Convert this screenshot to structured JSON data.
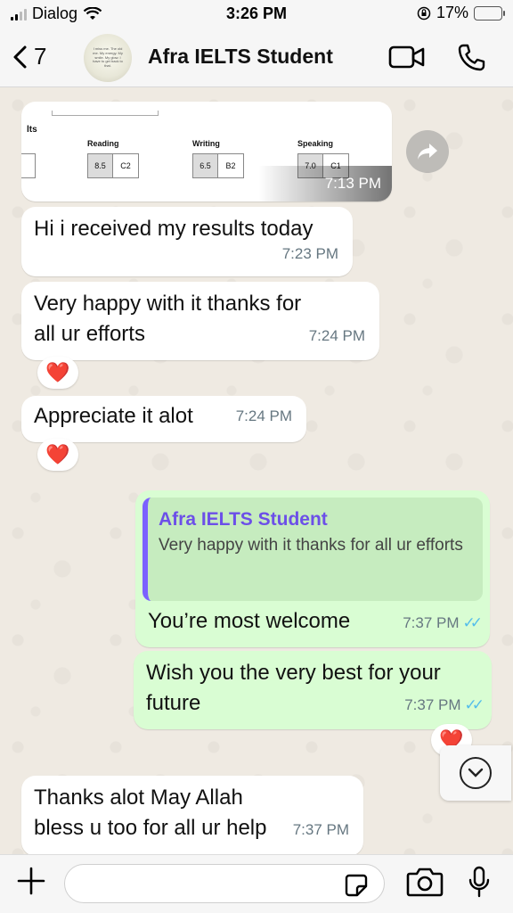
{
  "status": {
    "carrier": "Dialog",
    "time": "3:26 PM",
    "battery": "17%",
    "battery_level": 0.17
  },
  "header": {
    "back_count": "7",
    "title": "Afra IELTS Student",
    "avatar_text": "I miss me. The old me. My energy. My smile. My glow. I have to get back to that."
  },
  "image_message": {
    "partial_label": "lts",
    "columns": [
      {
        "label": "Reading",
        "score": "8.5",
        "level": "C2"
      },
      {
        "label": "Writing",
        "score": "6.5",
        "level": "B2"
      },
      {
        "label": "Speaking",
        "score": "7.0",
        "level": "C1"
      }
    ],
    "time": "7:13 PM"
  },
  "messages": [
    {
      "id": "m1",
      "dir": "in",
      "text": "Hi i received my results today",
      "time": "7:23 PM"
    },
    {
      "id": "m2",
      "dir": "in",
      "text": "Very happy with it thanks for all ur efforts",
      "time": "7:24 PM",
      "reaction": "❤️"
    },
    {
      "id": "m3",
      "dir": "in",
      "text": "Appreciate it alot",
      "time": "7:24 PM",
      "reaction": "❤️"
    },
    {
      "id": "m4",
      "dir": "out",
      "quote_name": "Afra IELTS Student",
      "quote_text": "Very happy with it thanks for all ur efforts",
      "text": "You’re most welcome",
      "time": "7:37 PM"
    },
    {
      "id": "m5",
      "dir": "out",
      "text": "Wish you the very best for your future",
      "time": "7:37 PM",
      "reaction": "❤️"
    },
    {
      "id": "m6",
      "dir": "in",
      "text": "Thanks alot May Allah bless u too for all ur help",
      "time": "7:37 PM"
    }
  ],
  "composer": {
    "placeholder": ""
  },
  "icons": {
    "back": "chevron-left-icon",
    "video": "video-camera-icon",
    "call": "phone-icon",
    "forward": "forward-icon",
    "scroll": "chevron-down-icon",
    "plus": "plus-icon",
    "sticker": "sticker-icon",
    "camera": "camera-icon",
    "mic": "microphone-icon"
  },
  "colors": {
    "incoming": "#ffffff",
    "outgoing": "#d9fdd3",
    "quote_accent": "#7b61ff",
    "read_ticks": "#53bdeb"
  }
}
